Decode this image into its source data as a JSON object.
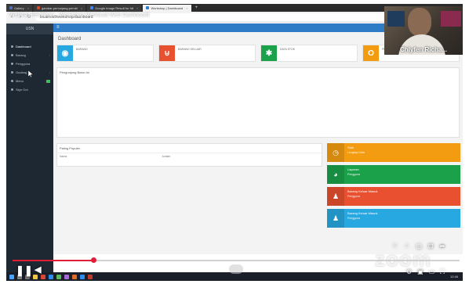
{
  "browser": {
    "tabs": [
      {
        "label": "Gallery",
        "color": "#4e6fb3"
      },
      {
        "label": "gambar-penunjang-pembi",
        "color": "#d24a2b"
      },
      {
        "label": "Google Image Result for htt",
        "color": "#4285f4"
      },
      {
        "label": "Workshop | Dashboard",
        "color": "#2f7cc6"
      }
    ],
    "new_tab": "+",
    "url": "localhost/workshop/dashboard",
    "banner": "Webinar Pelatihan - Workshop Membuat Web Dashboard"
  },
  "sidebar": {
    "brand": "USN",
    "items": [
      {
        "label": "Dashboard",
        "chevron": ""
      },
      {
        "label": "Barang",
        "chevron": "‹"
      },
      {
        "label": "Pengguna",
        "chevron": ""
      },
      {
        "label": "Gudang",
        "chevron": "‹"
      },
      {
        "label": "Menu",
        "chevron": ""
      },
      {
        "label": "Sign Out",
        "chevron": ""
      }
    ]
  },
  "main": {
    "title": "Dashboard",
    "stats": [
      {
        "label": "Barang",
        "color": "#28a8e0",
        "glyph": "◉"
      },
      {
        "label": "Barang Keluar",
        "color": "#e8502f",
        "glyph": "⊍"
      },
      {
        "label": "Data Stok",
        "color": "#1aa14a",
        "glyph": "✱"
      },
      {
        "label": "Pengguna",
        "color": "#f39c12",
        "glyph": "O"
      }
    ],
    "chart_panel_title": "Pengunjung Bulan Ini",
    "popular_title": "Paling Populer",
    "popular_columns": [
      "Nama",
      "Jumlah"
    ],
    "info_boxes": [
      {
        "title": "Stok",
        "sub": "Lengkap Data",
        "color": "#f39c12",
        "glyph": "◷"
      },
      {
        "title": "Laporan",
        "sub": "Pengguna",
        "color": "#1aa14a",
        "glyph": "◕"
      },
      {
        "title": "Barang Keluar Masuk",
        "sub": "Pengguna",
        "color": "#e8502f",
        "glyph": "♟"
      },
      {
        "title": "Barang Keluar Masuk",
        "sub": "Pengguna",
        "color": "#28a8e0",
        "glyph": "♟"
      }
    ]
  },
  "webcam": {
    "name": "Chlyfen Richa..."
  },
  "player": {
    "progress_percent": 18,
    "zoom_watermark": "zoom",
    "taskbar_time": "12:46"
  }
}
